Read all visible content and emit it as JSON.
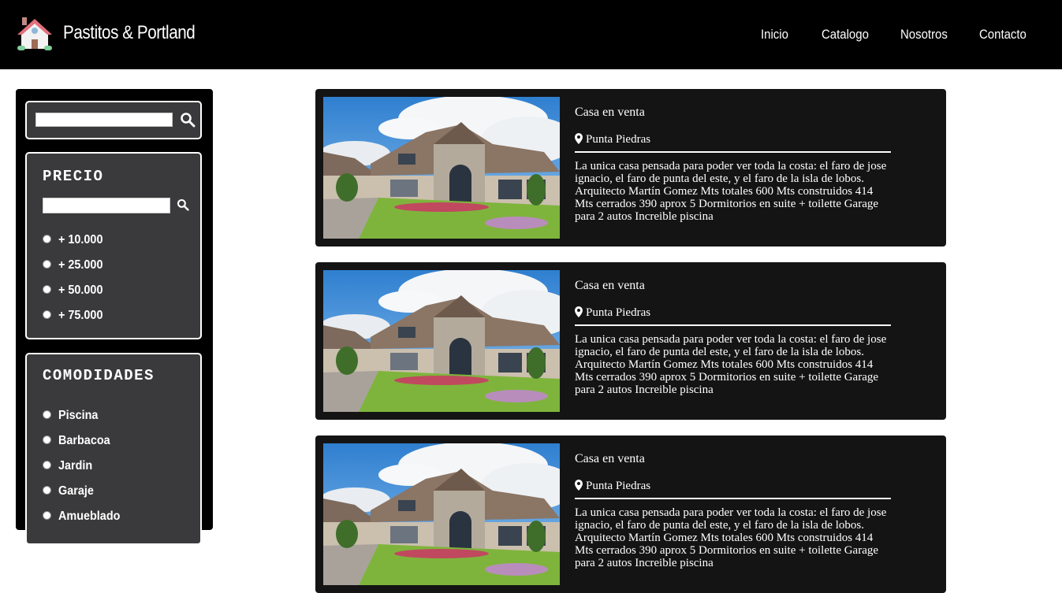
{
  "brand": {
    "name": "Pastitos & Portland",
    "logo_icon": "house-icon"
  },
  "nav": {
    "items": [
      "Inicio",
      "Catalogo",
      "Nosotros",
      "Contacto"
    ]
  },
  "sidebar": {
    "search": {
      "value": "",
      "icon": "search-icon"
    },
    "price": {
      "title": "PRECIO",
      "value": "",
      "options": [
        "+ 10.000",
        "+ 25.000",
        "+ 50.000",
        "+ 75.000"
      ]
    },
    "amenities": {
      "title": "COMODIDADES",
      "options": [
        "Piscina",
        "Barbacoa",
        "Jardin",
        "Garaje",
        "Amueblado"
      ]
    }
  },
  "listings": [
    {
      "title": "Casa en venta",
      "location": "Punta Piedras",
      "description": "La unica casa pensada para poder ver toda la costa: el faro de jose ignacio, el faro de punta del este, y el faro de la isla de lobos. Arquitecto Martín Gomez Mts totales 600 Mts construidos 414 Mts cerrados 390 aprox 5 Dormitorios en suite + toilette Garage para 2 autos Increible piscina"
    },
    {
      "title": "Casa en venta",
      "location": "Punta Piedras",
      "description": "La unica casa pensada para poder ver toda la costa: el faro de jose ignacio, el faro de punta del este, y el faro de la isla de lobos. Arquitecto Martín Gomez Mts totales 600 Mts construidos 414 Mts cerrados 390 aprox 5 Dormitorios en suite + toilette Garage para 2 autos Increible piscina"
    },
    {
      "title": "Casa en venta",
      "location": "Punta Piedras",
      "description": "La unica casa pensada para poder ver toda la costa: el faro de jose ignacio, el faro de punta del este, y el faro de la isla de lobos. Arquitecto Martín Gomez Mts totales 600 Mts construidos 414 Mts cerrados 390 aprox 5 Dormitorios en suite + toilette Garage para 2 autos Increible piscina"
    }
  ]
}
